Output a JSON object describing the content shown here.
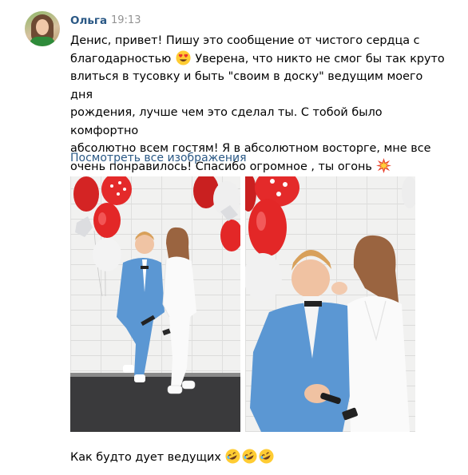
{
  "post": {
    "author": "Ольга",
    "time": "19:13",
    "message_lines": [
      "Денис, привет! Пишу это сообщение от чистого сердца с",
      "благодарностью",
      "Уверена, что никто не смог бы так круто",
      "влиться в тусовку и быть \"своим в доску\" ведущим моего дня",
      "рождения, лучше чем это сделал ты. С тобой было комфортно",
      "абсолютно всем гостям! Я в абсолютном восторге, мне все",
      "очень понравилось! Спасибо огромное , ты огонь"
    ],
    "emoji": {
      "heart_eyes": "smiling-face-with-heart-eyes-icon",
      "collision": "collision-icon",
      "rofl": "rolling-on-the-floor-laughing-icon"
    },
    "view_all_label": "Посмотреть все изображения",
    "photos": [
      "photo-couple-with-balloons-full",
      "photo-couple-with-balloons-closeup"
    ],
    "footer_text": "Как будто дует ведущих"
  },
  "colors": {
    "link": "#2a5885",
    "time": "#939393",
    "text": "#000000",
    "suit_blue": "#5b97d3",
    "balloon_red": "#e42a2a"
  }
}
